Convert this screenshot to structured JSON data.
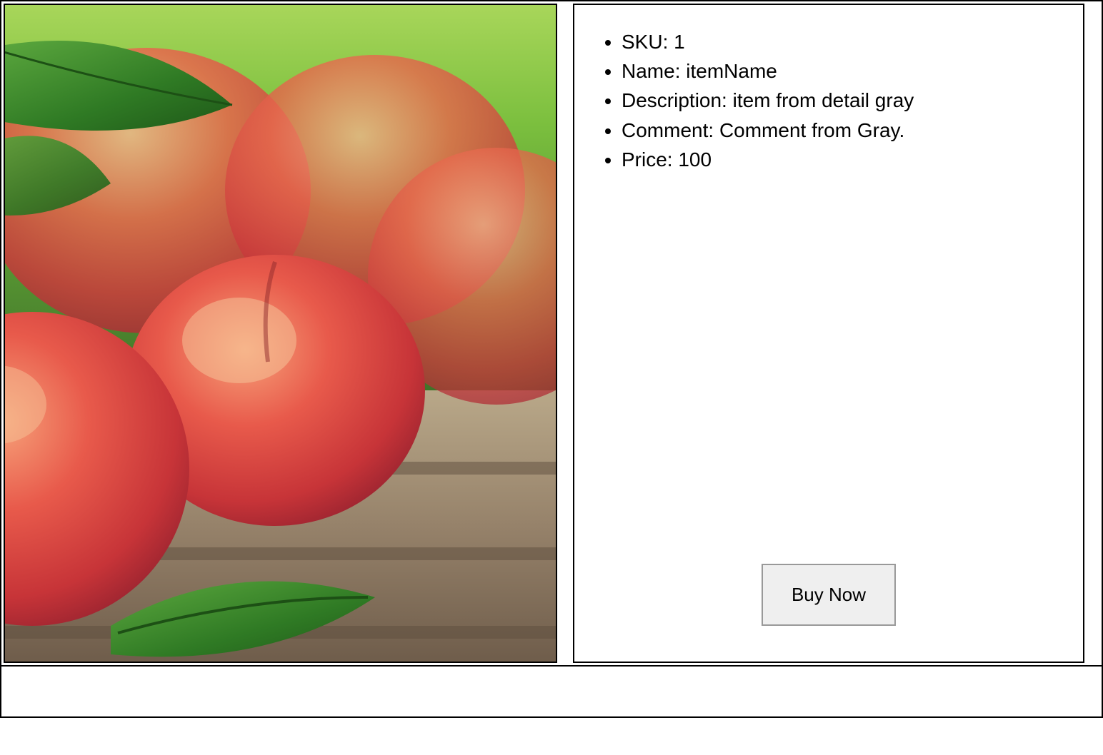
{
  "product": {
    "sku_label": "SKU: ",
    "sku_value": "1",
    "name_label": "Name: ",
    "name_value": "itemName",
    "description_label": "Description: ",
    "description_value": "item from detail gray",
    "comment_label": "Comment: ",
    "comment_value": "Comment from Gray.",
    "price_label": "Price: ",
    "price_value": "100",
    "image_alt": "peaches"
  },
  "actions": {
    "buy_label": "Buy Now"
  }
}
